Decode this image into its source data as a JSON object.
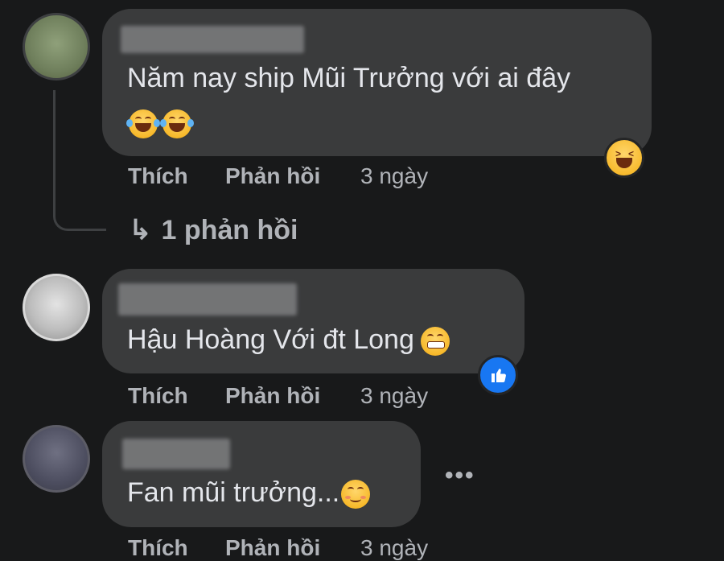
{
  "comments": [
    {
      "text": "Năm nay ship Mũi Trưởng với ai đây",
      "emojis": [
        "rolling-on-floor-laughing-emoji",
        "rolling-on-floor-laughing-emoji"
      ],
      "reaction_icon": "grinning-squinting-face-icon",
      "actions": {
        "like": "Thích",
        "reply": "Phản hồi",
        "time": "3 ngày"
      },
      "view_replies": "1 phản hồi"
    },
    {
      "text": "Hậu Hoàng Với đt Long",
      "emoji": "grinning-face-with-smiling-eyes-emoji",
      "reaction_icon": "thumbs-up-icon",
      "actions": {
        "like": "Thích",
        "reply": "Phản hồi",
        "time": "3 ngày"
      }
    },
    {
      "text": "Fan mũi trưởng...",
      "emoji": "smiling-face-emoji",
      "more_icon": "more-options-icon",
      "more_label": "•••",
      "actions": {
        "like": "Thích",
        "reply": "Phản hồi",
        "time": "3 ngày"
      }
    }
  ],
  "colors": {
    "background": "#18191a",
    "bubble": "#3a3b3c",
    "text": "#e4e6eb",
    "secondary_text": "#b0b3b8",
    "like_blue": "#1877f2"
  }
}
